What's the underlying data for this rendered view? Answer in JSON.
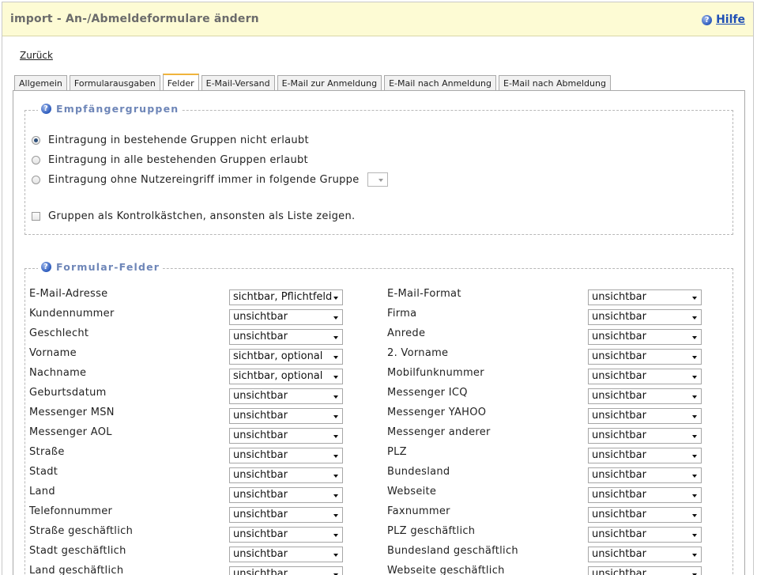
{
  "header": {
    "title": "import - An-/Abmeldeformulare ändern",
    "help_label": "Hilfe"
  },
  "back_label": "Zurück",
  "tabs": [
    {
      "label": "Allgemein",
      "active": false
    },
    {
      "label": "Formularausgaben",
      "active": false
    },
    {
      "label": "Felder",
      "active": true
    },
    {
      "label": "E-Mail-Versand",
      "active": false
    },
    {
      "label": "E-Mail zur Anmeldung",
      "active": false
    },
    {
      "label": "E-Mail nach Anmeldung",
      "active": false
    },
    {
      "label": "E-Mail nach Abmeldung",
      "active": false
    }
  ],
  "groups_section": {
    "legend": "Empfängergruppen",
    "radio_options": [
      {
        "label": "Eintragung in bestehende Gruppen nicht erlaubt",
        "checked": true
      },
      {
        "label": "Eintragung in alle bestehenden Gruppen erlaubt",
        "checked": false
      },
      {
        "label": "Eintragung ohne Nutzereingriff immer in folgende Gruppe",
        "checked": false
      }
    ],
    "group_select_value": "",
    "checkbox_label": "Gruppen als Kontrolkästchen, ansonsten als Liste zeigen.",
    "checkbox_checked": false
  },
  "fields_section": {
    "legend": "Formular-Felder",
    "rows": [
      {
        "left_label": "E-Mail-Adresse",
        "left_value": "sichtbar, Pflichtfeld",
        "right_label": "E-Mail-Format",
        "right_value": "unsichtbar"
      },
      {
        "left_label": "Kundennummer",
        "left_value": "unsichtbar",
        "right_label": "Firma",
        "right_value": "unsichtbar"
      },
      {
        "left_label": "Geschlecht",
        "left_value": "unsichtbar",
        "right_label": "Anrede",
        "right_value": "unsichtbar"
      },
      {
        "left_label": "Vorname",
        "left_value": "sichtbar, optional",
        "right_label": "2. Vorname",
        "right_value": "unsichtbar"
      },
      {
        "left_label": "Nachname",
        "left_value": "sichtbar, optional",
        "right_label": "Mobilfunknummer",
        "right_value": "unsichtbar"
      },
      {
        "left_label": "Geburtsdatum",
        "left_value": "unsichtbar",
        "right_label": "Messenger ICQ",
        "right_value": "unsichtbar"
      },
      {
        "left_label": "Messenger MSN",
        "left_value": "unsichtbar",
        "right_label": "Messenger YAHOO",
        "right_value": "unsichtbar"
      },
      {
        "left_label": "Messenger AOL",
        "left_value": "unsichtbar",
        "right_label": "Messenger anderer",
        "right_value": "unsichtbar"
      },
      {
        "left_label": "Straße",
        "left_value": "unsichtbar",
        "right_label": "PLZ",
        "right_value": "unsichtbar"
      },
      {
        "left_label": "Stadt",
        "left_value": "unsichtbar",
        "right_label": "Bundesland",
        "right_value": "unsichtbar"
      },
      {
        "left_label": "Land",
        "left_value": "unsichtbar",
        "right_label": "Webseite",
        "right_value": "unsichtbar"
      },
      {
        "left_label": "Telefonnummer",
        "left_value": "unsichtbar",
        "right_label": "Faxnummer",
        "right_value": "unsichtbar"
      },
      {
        "left_label": "Straße geschäftlich",
        "left_value": "unsichtbar",
        "right_label": "PLZ geschäftlich",
        "right_value": "unsichtbar"
      },
      {
        "left_label": "Stadt geschäftlich",
        "left_value": "unsichtbar",
        "right_label": "Bundesland geschäftlich",
        "right_value": "unsichtbar"
      },
      {
        "left_label": "Land geschäftlich",
        "left_value": "unsichtbar",
        "right_label": "Webseite geschäftlich",
        "right_value": "unsichtbar"
      }
    ]
  },
  "icons": {
    "help": "question-circle-icon",
    "dropdown": "chevron-down-icon"
  },
  "colors": {
    "header_bg": "#fdfbd4",
    "legend_text": "#6e86b8",
    "link": "#1f4fb5",
    "active_tab_accent": "#f0b43c"
  }
}
